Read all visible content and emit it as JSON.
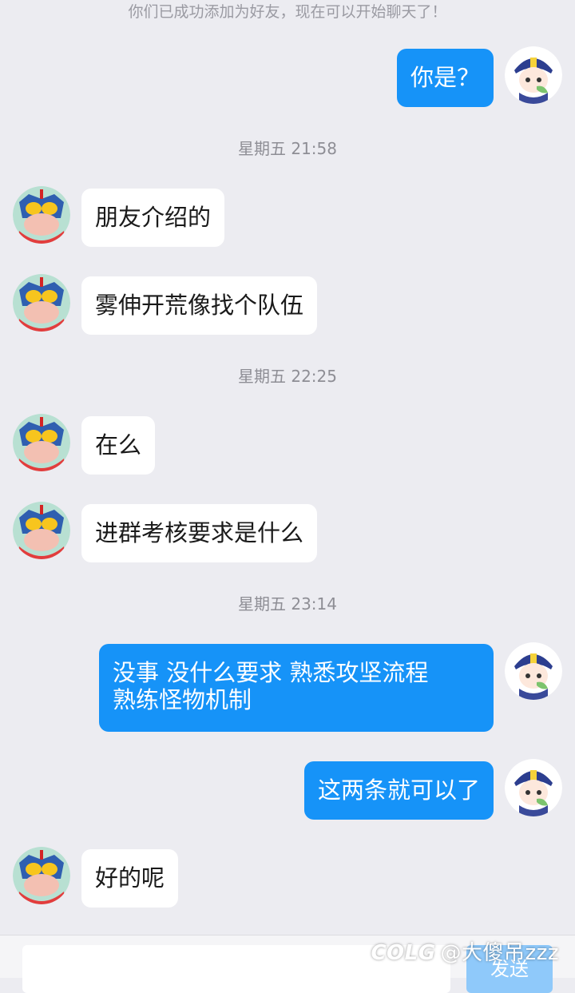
{
  "system_note": "你们已成功添加为好友，现在可以开始聊天了！",
  "timestamps": [
    "星期五 21:58",
    "星期五 22:25",
    "星期五 23:14"
  ],
  "messages": [
    {
      "from": "me",
      "text": "你是？"
    },
    {
      "from": "them",
      "text": "朋友介绍的"
    },
    {
      "from": "them",
      "text": "雾伸开荒像找个队伍"
    },
    {
      "from": "them",
      "text": "在么"
    },
    {
      "from": "them",
      "text": "进群考核要求是什么"
    },
    {
      "from": "me",
      "text": "没事 没什么要求 熟悉攻坚流程\n熟练怪物机制"
    },
    {
      "from": "me",
      "text": "这两条就可以了"
    },
    {
      "from": "them",
      "text": "好的呢"
    }
  ],
  "input": {
    "placeholder": "",
    "send_label": "发送"
  },
  "watermark": {
    "logo": "COLG",
    "text": "@大傻吊zzz"
  },
  "colors": {
    "background": "#ececf1",
    "my_bubble": "#1693f8",
    "their_bubble": "#ffffff",
    "timestamp_text": "#8e8e95"
  },
  "icons": {
    "my_avatar": "anime-girl-avatar-icon",
    "their_avatar": "superhero-mask-avatar-icon"
  }
}
